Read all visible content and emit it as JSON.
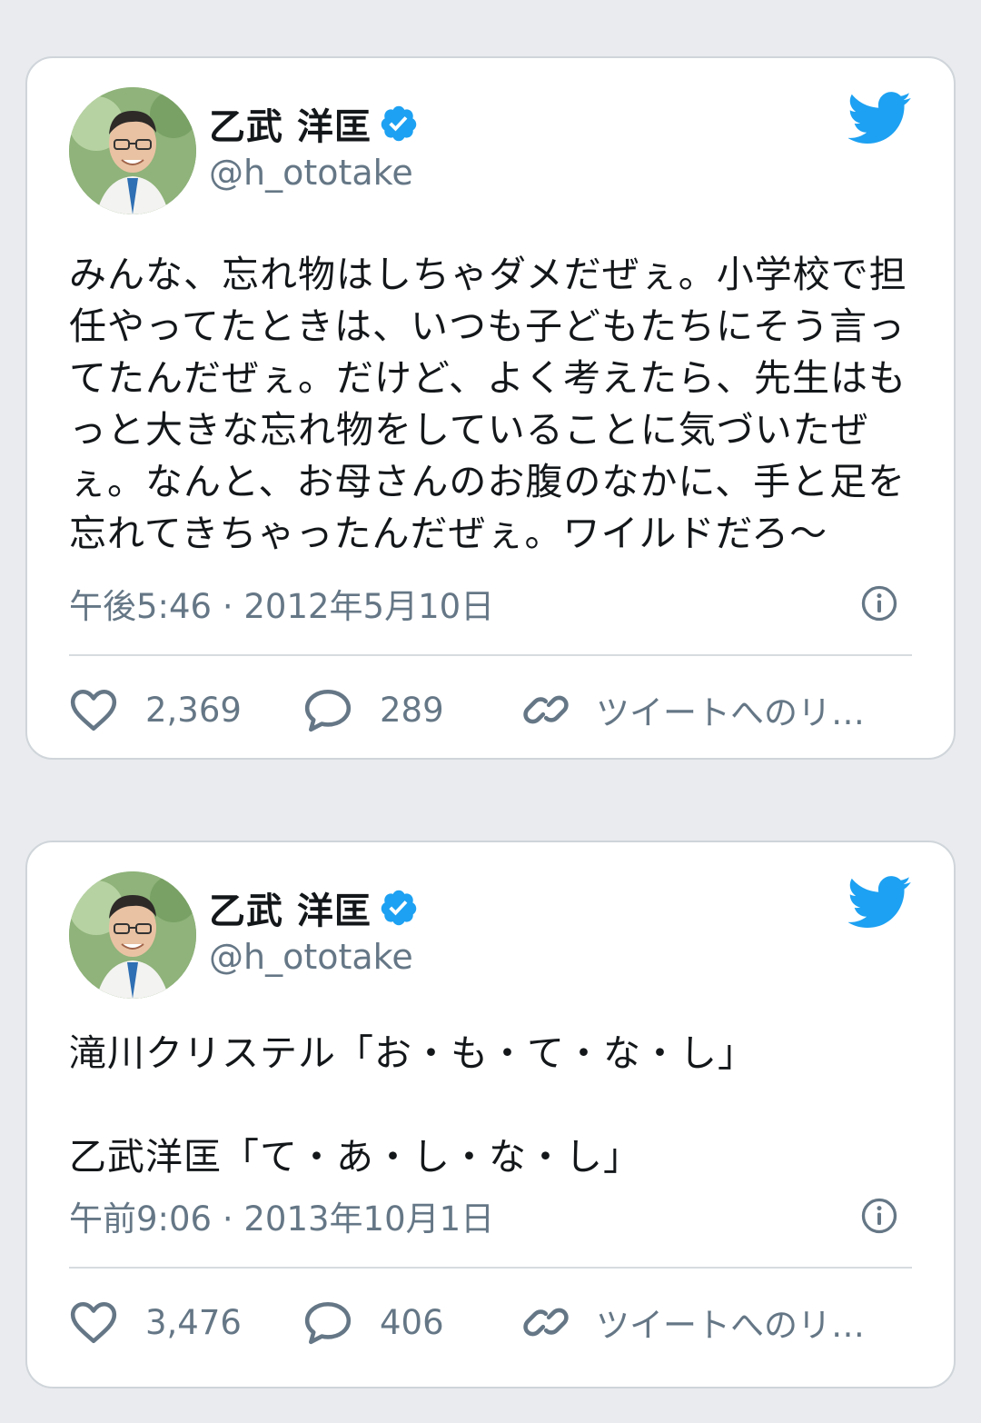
{
  "tweets": [
    {
      "display_name": "乙武 洋匡",
      "handle": "@h_ototake",
      "text": "みんな、忘れ物はしちゃダメだぜぇ。小学校で担任やってたときは、いつも子どもたちにそう言ってたんだぜぇ。だけど、よく考えたら、先生はもっと大きな忘れ物をしていることに気づいたぜぇ。なんと、お母さんのお腹のなかに、手と足を忘れてきちゃったんだぜぇ。ワイルドだろ〜",
      "timestamp": "午後5:46 · 2012年5月10日",
      "likes": "2,369",
      "replies": "289",
      "share_label": "ツイートへのリ…"
    },
    {
      "display_name": "乙武 洋匡",
      "handle": "@h_ototake",
      "text": "滝川クリステル「お・も・て・な・し」\n\n乙武洋匡「て・あ・し・な・し」",
      "timestamp": "午前9:06 · 2013年10月1日",
      "likes": "3,476",
      "replies": "406",
      "share_label": "ツイートへのリ…"
    }
  ],
  "icons": {
    "verified": "verified-badge-icon",
    "brand": "twitter-bird-icon",
    "info": "info-icon",
    "like": "heart-icon",
    "reply": "speech-bubble-icon",
    "share": "link-icon"
  },
  "colors": {
    "brand": "#1da1f2",
    "secondary_text": "#657786",
    "card_border": "#cfd5da"
  }
}
